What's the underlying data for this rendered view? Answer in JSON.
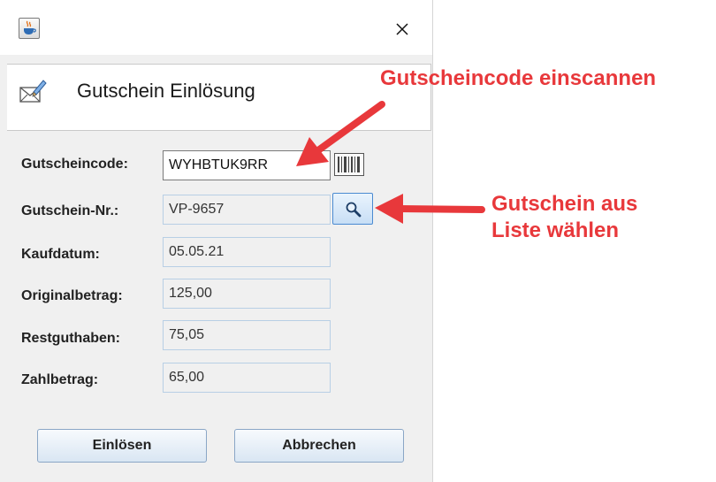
{
  "window": {
    "app_icon": "java-cup-icon",
    "close_icon": "close-icon"
  },
  "header": {
    "icon": "envelope-pen-icon",
    "title": "Gutschein Einlösung"
  },
  "form": {
    "gutscheincode": {
      "label": "Gutscheincode:",
      "value": "WYHBTUK9RR"
    },
    "gutschein_nr": {
      "label": "Gutschein-Nr.:",
      "value": "VP-9657"
    },
    "kaufdatum": {
      "label": "Kaufdatum:",
      "value": "05.05.21"
    },
    "originalbetrag": {
      "label": "Originalbetrag:",
      "value": "125,00"
    },
    "restguthaben": {
      "label": "Restguthaben:",
      "value": "75,05"
    },
    "zahlbetrag": {
      "label": "Zahlbetrag:",
      "value": "65,00"
    }
  },
  "icons": {
    "scan": "barcode-icon",
    "search": "magnifier-icon"
  },
  "buttons": {
    "redeem": "Einlösen",
    "cancel": "Abbrechen"
  },
  "annotations": {
    "scan_hint": "Gutscheincode einscannen",
    "list_hint_line1": "Gutschein aus",
    "list_hint_line2": "Liste wählen",
    "color": "#e8383b"
  }
}
